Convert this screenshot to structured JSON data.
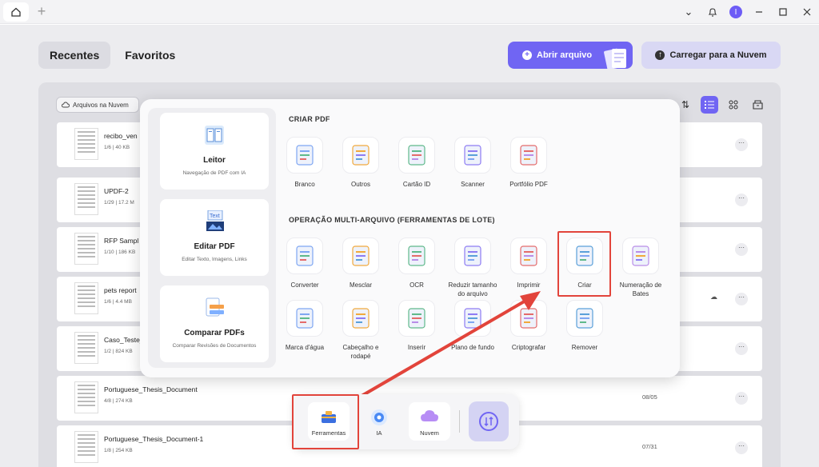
{
  "titlebar": {
    "add_tab": "+",
    "avatar_initial": "I"
  },
  "tabs": {
    "recent": "Recentes",
    "favorites": "Favoritos"
  },
  "actions": {
    "open_file": "Abrir arquivo",
    "upload_cloud": "Carregar para a Nuvem"
  },
  "toolbar": {
    "cloud_files": "Arquivos na Nuvem"
  },
  "files": [
    {
      "name": "recibo_ven",
      "meta": "1/6 | 40 KB",
      "date": ""
    },
    {
      "name": "UPDF-2",
      "meta": "1/29 | 17.2 M",
      "date": ""
    },
    {
      "name": "RFP Sampl",
      "meta": "1/10 | 186 KB",
      "date": ""
    },
    {
      "name": "pets report",
      "meta": "1/6 | 4.4 MB",
      "date": ""
    },
    {
      "name": "Caso_Teste_",
      "meta": "1/2 | 824 KB",
      "date": ""
    },
    {
      "name": "Portuguese_Thesis_Document",
      "meta": "4/8 | 274 KB",
      "date": "08/05"
    },
    {
      "name": "Portuguese_Thesis_Document-1",
      "meta": "1/8 | 254 KB",
      "date": "07/31"
    }
  ],
  "popup": {
    "left_tools": [
      {
        "title": "Leitor",
        "desc": "Navegação de PDF com IA",
        "icon": "reader-icon"
      },
      {
        "title": "Editar PDF",
        "desc": "Editar Texto, Imagens, Links",
        "icon": "edit-pdf-icon",
        "icon_text": "Text"
      },
      {
        "title": "Comparar PDFs",
        "desc": "Comparar Revisões de Documentos",
        "icon": "compare-icon"
      }
    ],
    "create_title": "CRIAR PDF",
    "create_items": [
      "Branco",
      "Outros",
      "Cartão ID",
      "Scanner",
      "Portfólio PDF"
    ],
    "batch_title": "OPERAÇÃO MULTI-ARQUIVO (FERRAMENTAS DE LOTE)",
    "batch_row1": [
      "Converter",
      "Mesclar",
      "OCR",
      "Reduzir tamanho do arquivo",
      "Imprimir",
      "Criar",
      "Numeração de Bates"
    ],
    "batch_row2": [
      "Marca d'água",
      "Cabeçalho e rodapé",
      "Inserir",
      "Plano de fundo",
      "Criptografar",
      "Remover"
    ]
  },
  "dock": {
    "tools": "Ferramentas",
    "ai": "IA",
    "cloud": "Nuvem"
  },
  "colors": {
    "accent": "#7065f3",
    "highlight": "#e2443b",
    "arrow": "#e2443b"
  }
}
